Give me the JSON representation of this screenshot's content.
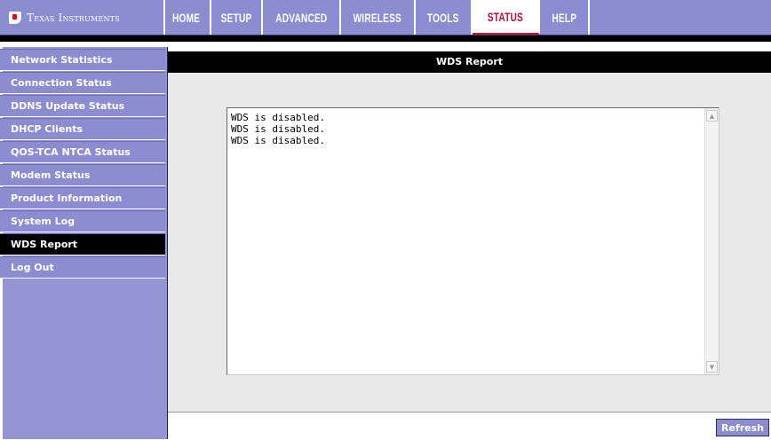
{
  "brand": {
    "name": "Texas Instruments",
    "logo_icon": "ti-logo-icon"
  },
  "nav": {
    "tabs": [
      {
        "label": "HOME"
      },
      {
        "label": "SETUP"
      },
      {
        "label": "ADVANCED"
      },
      {
        "label": "WIRELESS"
      },
      {
        "label": "TOOLS"
      },
      {
        "label": "STATUS"
      },
      {
        "label": "HELP"
      }
    ],
    "active": "STATUS"
  },
  "sidebar": {
    "items": [
      {
        "label": "Network Statistics"
      },
      {
        "label": "Connection Status"
      },
      {
        "label": "DDNS Update Status"
      },
      {
        "label": "DHCP Clients"
      },
      {
        "label": "QOS-TCA NTCA Status"
      },
      {
        "label": "Modem Status"
      },
      {
        "label": "Product Information"
      },
      {
        "label": "System Log"
      },
      {
        "label": "WDS Report"
      },
      {
        "label": "Log Out"
      }
    ],
    "active": "WDS Report"
  },
  "content": {
    "title": "WDS Report",
    "report_text": "WDS is disabled.\nWDS is disabled.\nWDS is disabled."
  },
  "actions": {
    "refresh_label": "Refresh"
  },
  "colors": {
    "nav_bg": "#8c8cd0",
    "active_tab_text": "#b0103a",
    "sidebar_active": "#000000",
    "header_bg": "#000000"
  }
}
